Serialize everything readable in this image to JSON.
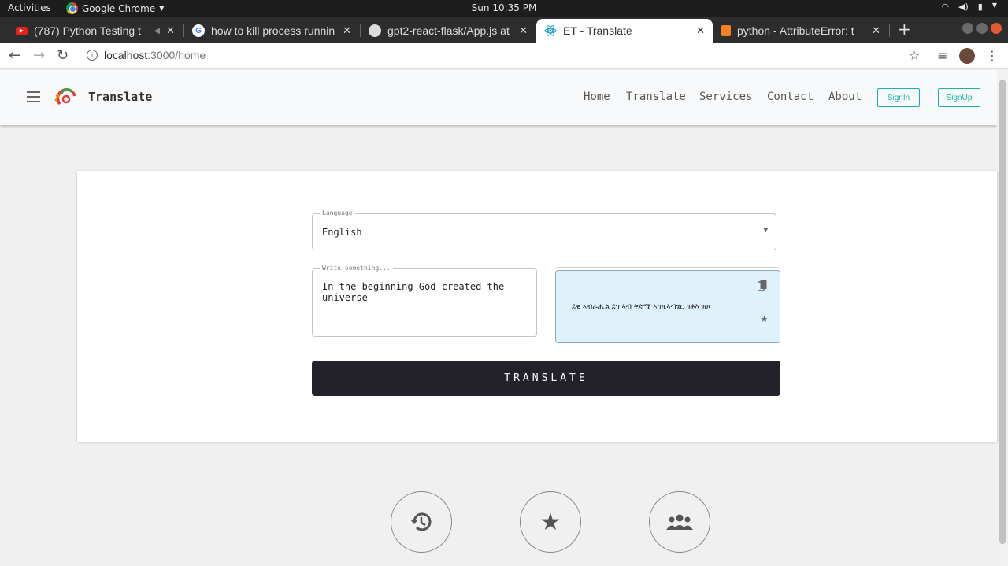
{
  "os": {
    "activities": "Activities",
    "app_name": "Google Chrome",
    "clock": "Sun 10:35 PM"
  },
  "browser": {
    "tabs": [
      {
        "title": "(787) Python Testing t",
        "favicon": "youtube-icon"
      },
      {
        "title": "how to kill process runnin",
        "favicon": "google-icon"
      },
      {
        "title": "gpt2-react-flask/App.js at",
        "favicon": "github-icon"
      },
      {
        "title": "ET - Translate",
        "favicon": "react-icon",
        "active": true
      },
      {
        "title": "python - AttributeError: t",
        "favicon": "stackoverflow-icon"
      }
    ],
    "url_host": "localhost",
    "url_path": ":3000/home"
  },
  "navbar": {
    "brand": "Translate",
    "links": [
      "Home",
      "Translate",
      "Services",
      "Contact",
      "About"
    ],
    "signin_label": "SignIn",
    "signup_label": "SignUp",
    "accent_color": "#17b4a8"
  },
  "form": {
    "language_legend": "Language",
    "language_value": "English",
    "input_legend": "Write something...",
    "input_value": "In the beginning God created the universe",
    "output_value": "ደቂ ኣብራሒል ደግ ኣብ ቅድሚ ኣግዚኣብሄር ከቶእ ዝዞ",
    "translate_label": "TRANSLATE",
    "output_bg": "#dff2fc"
  },
  "bottom_icons": [
    "history-icon",
    "star-icon",
    "group-icon"
  ]
}
